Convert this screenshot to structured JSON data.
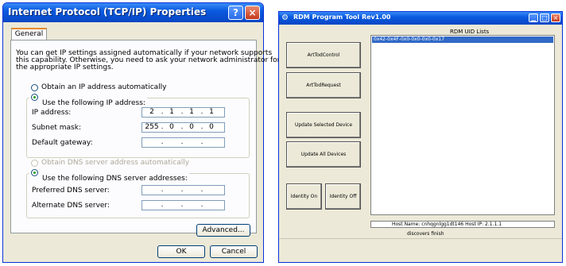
{
  "tcpip": {
    "title": "Internet Protocol (TCP/IP) Properties",
    "help": "?",
    "close": "×",
    "tab": "General",
    "intro": [
      "You can get IP settings assigned automatically if your network supports",
      "this capability. Otherwise, you need to ask your network administrator for",
      "the appropriate IP settings."
    ],
    "opt_auto_ip": "Obtain an IP address automatically",
    "opt_use_ip": "Use the following IP address:",
    "ip_label": "IP address:",
    "subnet_label": "Subnet mask:",
    "gateway_label": "Default gateway:",
    "ip_address": [
      "2",
      "1",
      "1",
      "1"
    ],
    "subnet_mask": [
      "255",
      "0",
      "0",
      "0"
    ],
    "gateway": [
      "",
      "",
      "",
      ""
    ],
    "opt_auto_dns": "Obtain DNS server address automatically",
    "opt_use_dns": "Use the following DNS server addresses:",
    "pref_dns_label": "Preferred DNS server:",
    "alt_dns_label": "Alternate DNS server:",
    "pref_dns": [
      "",
      "",
      "",
      ""
    ],
    "alt_dns": [
      "",
      "",
      "",
      ""
    ],
    "advanced": "Advanced...",
    "ok": "OK",
    "cancel": "Cancel"
  },
  "rdm": {
    "title": "RDM Program Tool Rev1.00",
    "uid_list_title": "RDM UID Lists",
    "uid_items": [
      "0x42-0x4F-0x0-0x0-0x0-0x17"
    ],
    "btn_todcontrol": "ArtTodControl",
    "btn_todrequest": "ArtTodRequest",
    "btn_update_selected": "Update Selected Device",
    "btn_update_all": "Update All Devices",
    "btn_identify_on": "Identity On",
    "btn_identify_off": "Identity Off",
    "host_info": "Host Name: cnhqgnlgg1dt146     Host IP: 2.1.1.1",
    "status": "discovers finish",
    "colors": {
      "selection": "#3169c6",
      "titlebar": "#0a5ae0"
    }
  }
}
